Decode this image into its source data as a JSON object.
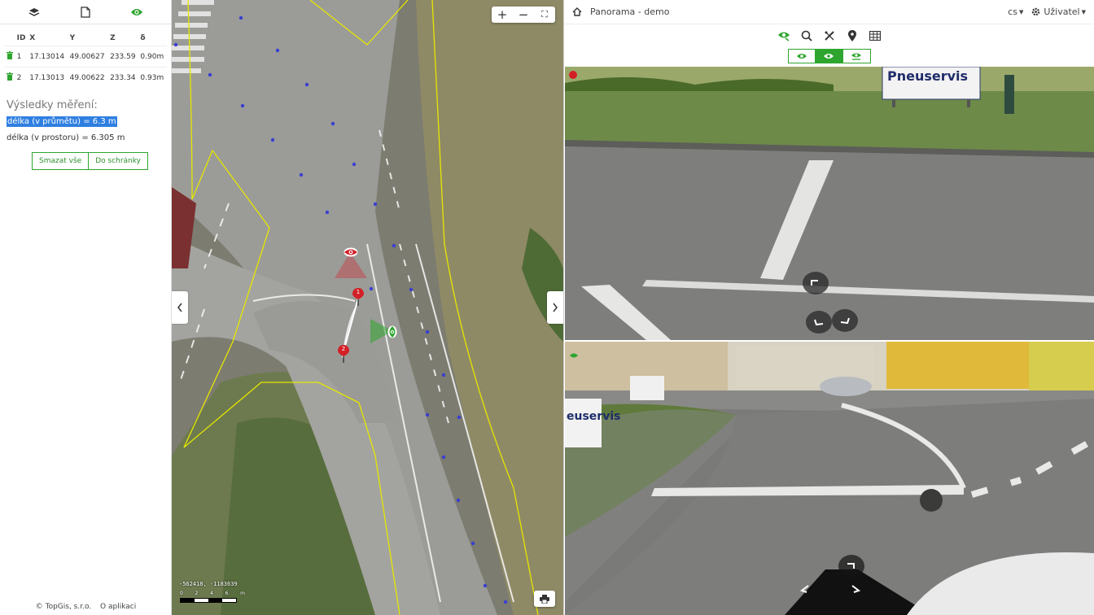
{
  "left_panel": {
    "toolbar": [
      {
        "icon": "layers-icon"
      },
      {
        "icon": "document-icon"
      },
      {
        "icon": "eye-icon",
        "color": "#2ea52e"
      }
    ],
    "table": {
      "headers": [
        "ID",
        "X",
        "Y",
        "Z",
        "δ"
      ],
      "rows": [
        {
          "id": "1",
          "x": "17.13014",
          "y": "49.00627",
          "z": "233.59",
          "delta": "0.90m"
        },
        {
          "id": "2",
          "x": "17.13013",
          "y": "49.00622",
          "z": "233.34",
          "delta": "0.93m"
        }
      ]
    },
    "results_title": "Výsledky měření:",
    "result_projection": "délka (v průmětu) = 6.3 m",
    "result_space": "délka (v prostoru) = 6.305 m",
    "buttons": {
      "clear_all": "Smazat vše",
      "to_clipboard": "Do schránky"
    },
    "footer": {
      "copyright": "© TopGis, s.r.o.",
      "about": "O aplikaci"
    }
  },
  "map": {
    "zoom_in": "+",
    "zoom_out": "−",
    "fullscreen": "⛶",
    "coord_readout": "-562418, -1183639",
    "scale_labels": [
      "0",
      "2",
      "4",
      "6",
      "m"
    ],
    "markers": [
      {
        "label": "1"
      },
      {
        "label": "2"
      }
    ]
  },
  "panorama": {
    "title": "Panorama - demo",
    "language": "cs",
    "user": "Uživatel",
    "tools": [
      "eye-tool-icon",
      "search-icon",
      "measure-icon",
      "pin-icon",
      "table-icon"
    ],
    "modes": [
      "mode-single-icon",
      "mode-split-icon",
      "mode-other-icon"
    ],
    "active_mode": 1,
    "sign_text": "Pneuservis",
    "bottom_sign_text": "euservis"
  },
  "colors": {
    "accent": "#2ea52e",
    "selection": "#2f7fe1",
    "marker_red": "#d32027",
    "polygon": "#e6e600",
    "dots": "#3a3fd0"
  }
}
